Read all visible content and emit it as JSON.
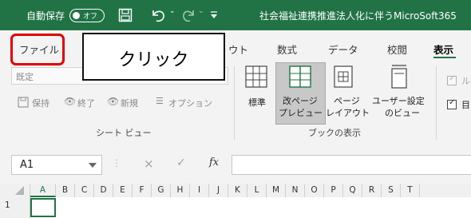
{
  "titlebar": {
    "autosave_label": "自動保存",
    "autosave_state": "オフ",
    "save_icon": "save-icon",
    "undo_icon": "undo-icon",
    "redo_icon": "redo-icon",
    "customize_icon": "customize-qat-icon",
    "doc_title": "社会福祉連携推進法人化に伴うMicroSoft365"
  },
  "tabs": {
    "file": "ファイル",
    "hidden_partial": "ウト",
    "formulas": "数式",
    "data": "データ",
    "review": "校閲",
    "view": "表示"
  },
  "callout": {
    "text": "クリック",
    "frame_color": "#e00000"
  },
  "ribbon": {
    "sheet_view": {
      "dropdown_value": "既定",
      "keep_label": "保持",
      "exit_label": "終了",
      "new_label": "新規",
      "options_label": "オプション",
      "group_label": "シート ビュー"
    },
    "workbook_views": {
      "normal_label": "標準",
      "page_break_line1": "改ページ",
      "page_break_line2": "プレビュー",
      "page_layout_line1": "ページ",
      "page_layout_line2": "レイアウト",
      "custom_line1": "ユーザー設定",
      "custom_line2": "のビュー",
      "group_label": "ブックの表示"
    },
    "show": {
      "ruler_partial": "ル",
      "gridlines_partial": "目"
    }
  },
  "formula_bar": {
    "name_box": "A1",
    "cancel_icon": "×",
    "enter_icon": "✓",
    "fx_label": "fx"
  },
  "grid": {
    "columns": [
      "A",
      "B",
      "C",
      "D",
      "E",
      "F",
      "G",
      "H",
      "I",
      "J",
      "K",
      "L",
      "M",
      "N",
      "O",
      "P",
      "Q",
      "R",
      "S",
      "T"
    ],
    "row_label": "1"
  },
  "colors": {
    "excel_green": "#217346",
    "highlight_red": "#e00000"
  }
}
